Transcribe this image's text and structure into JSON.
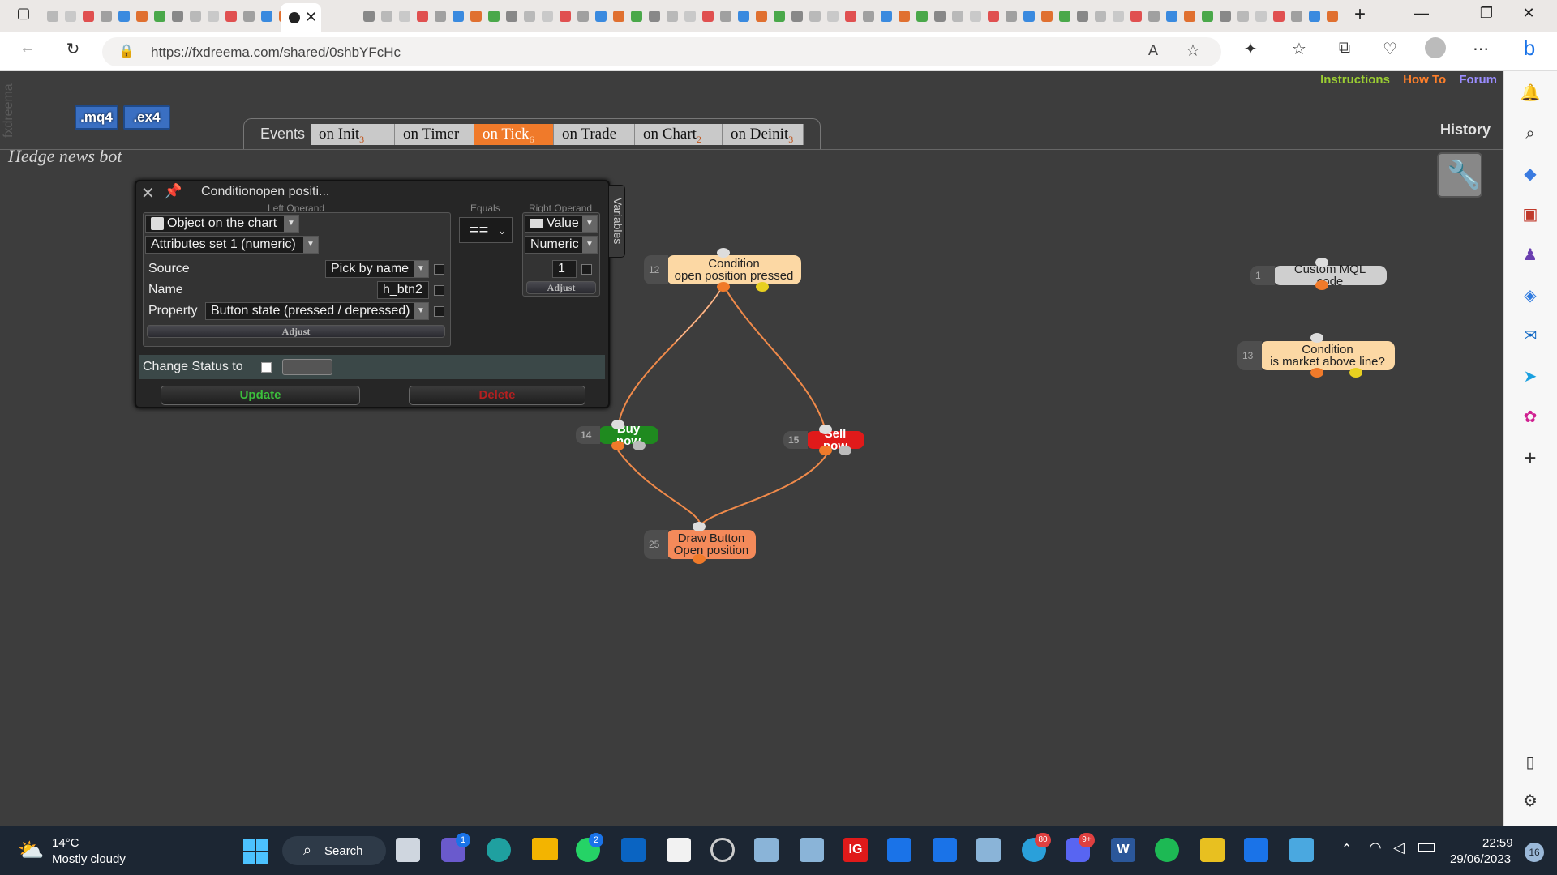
{
  "browser": {
    "url": "https://fxdreema.com/shared/0shbYFcHc",
    "tab_glyphs": [
      "WG",
      "a",
      "IG"
    ]
  },
  "app": {
    "vertical_logo": "fxdreema",
    "links": {
      "instructions": "Instructions",
      "how_to": "How To",
      "forum": "Forum"
    },
    "download_buttons": {
      "mq4": ".mq4",
      "ex4": ".ex4"
    },
    "project_name": "Hedge news bot",
    "history_title": "History",
    "events": {
      "label": "Events",
      "tabs": [
        {
          "label": "on Init",
          "count": "3"
        },
        {
          "label": "on Timer",
          "count": ""
        },
        {
          "label": "on Tick",
          "count": "6"
        },
        {
          "label": "on Trade",
          "count": ""
        },
        {
          "label": "on Chart",
          "count": "2"
        },
        {
          "label": "on Deinit",
          "count": "3"
        }
      ],
      "active_index": 2
    }
  },
  "panel": {
    "title": "Conditionopen positi...",
    "variables_tab": "Variables",
    "left_operand": {
      "caption": "Left Operand",
      "object_type": "Object on the chart",
      "attribute_set": "Attributes set 1 (numeric)",
      "source_label": "Source",
      "source_value": "Pick by name",
      "name_label": "Name",
      "name_value": "h_btn2",
      "property_label": "Property",
      "property_value": "Button state (pressed / depressed)",
      "adjust": "Adjust"
    },
    "operator": {
      "caption": "Equals",
      "value": "=="
    },
    "right_operand": {
      "caption": "Right Operand",
      "type": "Value",
      "kind": "Numeric",
      "value": "1",
      "adjust": "Adjust"
    },
    "change_status_label": "Change Status to",
    "update_label": "Update",
    "delete_label": "Delete"
  },
  "nodes": [
    {
      "id": "12",
      "line1": "Condition",
      "line2": "open position pressed",
      "color": "#fcd8a4"
    },
    {
      "id": "14",
      "line1": "Buy now",
      "line2": "",
      "color": "#1f8a1f"
    },
    {
      "id": "15",
      "line1": "Sell now",
      "line2": "",
      "color": "#e01a1a"
    },
    {
      "id": "25",
      "line1": "Draw Button",
      "line2": "Open position",
      "color": "#f48a5a"
    },
    {
      "id": "1",
      "line1": "Custom MQL code",
      "line2": "",
      "color": "#cfcfcf"
    },
    {
      "id": "13",
      "line1": "Condition",
      "line2": "is market above line?",
      "color": "#fcd8a4"
    }
  ],
  "taskbar": {
    "temperature": "14°C",
    "weather": "Mostly cloudy",
    "search": "Search",
    "time": "22:59",
    "date": "29/06/2023",
    "notification_count": "16",
    "badges": {
      "teams": "1",
      "whatsapp": "2",
      "telegram": "80",
      "discord": "9+"
    },
    "ig_label": "IG",
    "word_label": "W"
  },
  "colors": {
    "accent_orange": "#f07a2a",
    "link_green": "#9acd32",
    "link_orange": "#ff7f2a",
    "link_purple": "#9a8cff"
  }
}
